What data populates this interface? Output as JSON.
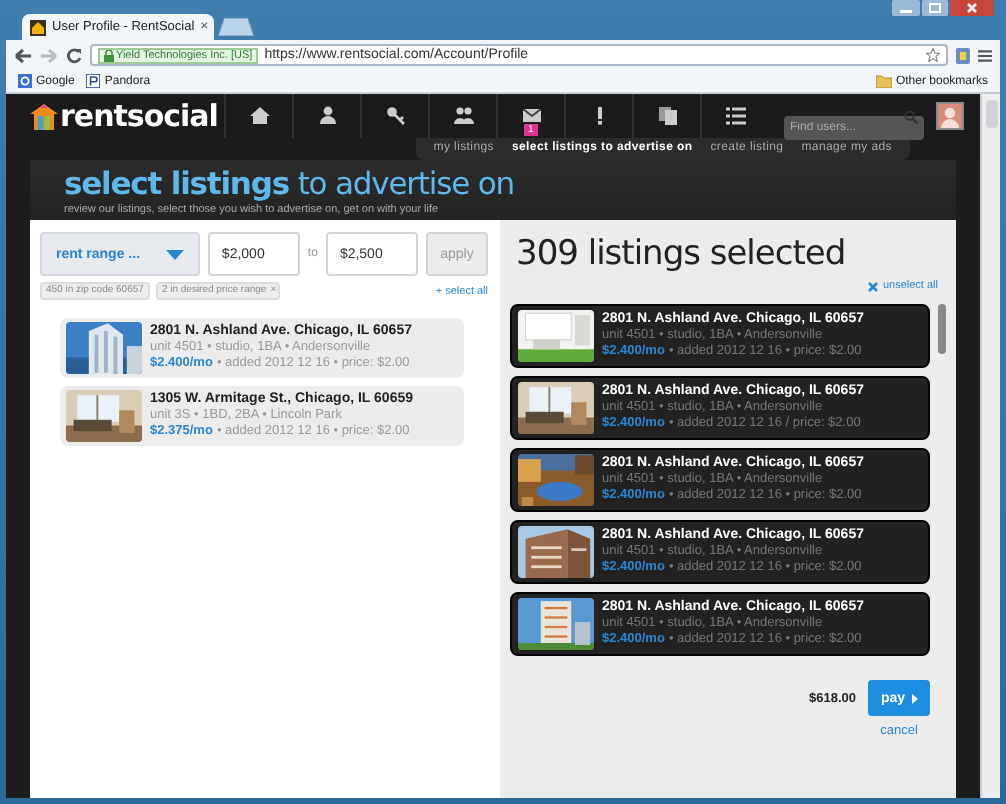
{
  "browser": {
    "tab_title": "User Profile - RentSocial",
    "tab_close": "×",
    "identity": "Yield Technologies Inc. [US]",
    "url": "https://www.rentsocial.com/Account/Profile",
    "bookmarks": [
      {
        "label": "Google",
        "kind": "google"
      },
      {
        "label": "Pandora",
        "kind": "pandora"
      }
    ],
    "other_bookmarks": "Other bookmarks"
  },
  "header": {
    "logo": "rentsocial",
    "nav_icons": [
      {
        "kind": "home"
      },
      {
        "kind": "person"
      },
      {
        "kind": "key"
      },
      {
        "kind": "people"
      },
      {
        "kind": "mail",
        "badge": "1"
      },
      {
        "kind": "alert"
      },
      {
        "kind": "documents"
      },
      {
        "kind": "list"
      }
    ],
    "search": {
      "placeholder": "Find users..."
    }
  },
  "subnav": [
    {
      "label": "my listings",
      "selected": false
    },
    {
      "label": "select listings to advertise on",
      "selected": true
    },
    {
      "label": "create listing",
      "selected": false
    },
    {
      "label": "manage my ads",
      "selected": false
    }
  ],
  "heading": {
    "title": "**select listings** to advertise on",
    "subtitle": "review our listings, select those you wish to advertise on, get on with your life"
  },
  "filters": {
    "dropdown": "rent range ...",
    "min": "$2,000",
    "separator": "to",
    "max": "$2,500",
    "apply": "apply",
    "tags": [
      {
        "label": "450 in zip code 60657",
        "removable": false
      },
      {
        "label": "2 in desired price range",
        "removable": true,
        "remove": "×"
      }
    ],
    "select_all": "+ select all"
  },
  "available": [
    {
      "address": "2801 N. Ashland Ave. Chicago, IL 60657",
      "details": "unit 4501 • studio, 1BA • Andersonville",
      "rent": "$2.400/mo",
      "meta": "• added 2012 12 16 • price: $2.00"
    },
    {
      "address": "1305 W. Armitage St., Chicago, IL 60659",
      "details": "unit 3S • 1BD, 2BA • Lincoln Park",
      "rent": "$2.375/mo",
      "meta": "• added 2012 12 16 • price: $2.00"
    }
  ],
  "selected_panel": {
    "title": "309 listings selected",
    "unselect_all": "unselect all",
    "listings": [
      {
        "address": "2801 N. Ashland Ave. Chicago, IL 60657",
        "details": "unit 4501 • studio, 1BA • Andersonville",
        "rent": "$2.400/mo",
        "meta": "• added 2012 12 16 • price: $2.00"
      },
      {
        "address": "2801 N. Ashland Ave. Chicago, IL 60657",
        "details": "unit 4501 • studio, 1BA • Andersonville",
        "rent": "$2.400/mo",
        "meta": "• added 2012 12 16 / price: $2.00"
      },
      {
        "address": "2801 N. Ashland Ave. Chicago, IL 60657",
        "details": "unit 4501 • studio, 1BA • Andersonville",
        "rent": "$2.400/mo",
        "meta": "• added 2012 12 16 • price: $2.00"
      },
      {
        "address": "2801 N. Ashland Ave. Chicago, IL 60657",
        "details": "unit 4501 • studio, 1BA • Andersonville",
        "rent": "$2.400/mo",
        "meta": "• added 2012 12 16 • price: $2.00"
      },
      {
        "address": "2801 N. Ashland Ave. Chicago, IL 60657",
        "details": "unit 4501 • studio, 1BA • Andersonville",
        "rent": "$2.400/mo",
        "meta": "• added 2012 12 16 • price: $2.00"
      }
    ],
    "total": "$618.00",
    "pay": "pay",
    "cancel": "cancel"
  }
}
